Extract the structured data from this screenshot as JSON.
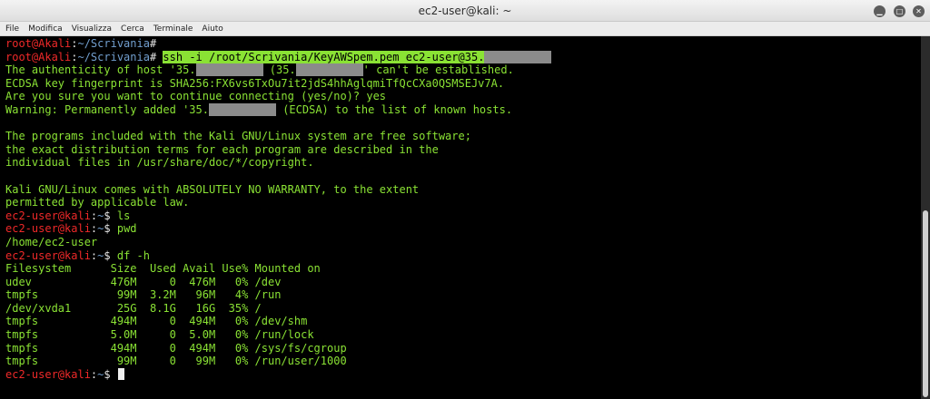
{
  "window": {
    "title": "ec2-user@kali: ~",
    "minimize_icon": "minimize-icon",
    "maximize_icon": "maximize-icon",
    "close_icon": "close-icon"
  },
  "menu": [
    "File",
    "Modifica",
    "Visualizza",
    "Cerca",
    "Terminale",
    "Aiuto"
  ],
  "colors": {
    "user_red": "#ef2929",
    "path_blue": "#729fcf",
    "text_green": "#8ae234",
    "highlight": "#8ae234",
    "redaction": "#8b8b8b"
  },
  "terminal": {
    "prompt1": {
      "user": "root@Akali",
      "sep": ":",
      "path": "~/Scrivania",
      "sym": "#"
    },
    "prompt2": {
      "user": "root@Akali",
      "sep": ":",
      "path": "~/Scrivania",
      "sym": "# ",
      "command": "ssh -i /root/Scrivania/KeyAWSpem.pem ec2-user@35."
    },
    "auth1_a": "The authenticity of host '35.",
    "auth1_b": " (35.",
    "auth1_c": "' can't be established.",
    "fingerprint": "ECDSA key fingerprint is SHA256:FX6vs6TxOu7it2jdS4hhAglqmiTfQcCXa0QSMSEJv7A.",
    "confirm": "Are you sure you want to continue connecting (yes/no)? yes",
    "warning_a": "Warning: Permanently added '35.",
    "warning_b": " (ECDSA) to the list of known hosts.",
    "blank": "",
    "motd1": "The programs included with the Kali GNU/Linux system are free software;",
    "motd2": "the exact distribution terms for each program are described in the",
    "motd3": "individual files in /usr/share/doc/*/copyright.",
    "motd4": "Kali GNU/Linux comes with ABSOLUTELY NO WARRANTY, to the extent",
    "motd5": "permitted by applicable law.",
    "ec2_prompt": {
      "user": "ec2-user@kali",
      "sep": ":",
      "path": "~",
      "sym": "$ "
    },
    "cmd_ls": "ls",
    "cmd_pwd": "pwd",
    "out_pwd": "/home/ec2-user",
    "cmd_df": "df -h",
    "df_rows": [
      "Filesystem      Size  Used Avail Use% Mounted on",
      "udev            476M     0  476M   0% /dev",
      "tmpfs            99M  3.2M   96M   4% /run",
      "/dev/xvda1       25G  8.1G   16G  35% /",
      "tmpfs           494M     0  494M   0% /dev/shm",
      "tmpfs           5.0M     0  5.0M   0% /run/lock",
      "tmpfs           494M     0  494M   0% /sys/fs/cgroup",
      "tmpfs            99M     0   99M   0% /run/user/1000"
    ]
  }
}
